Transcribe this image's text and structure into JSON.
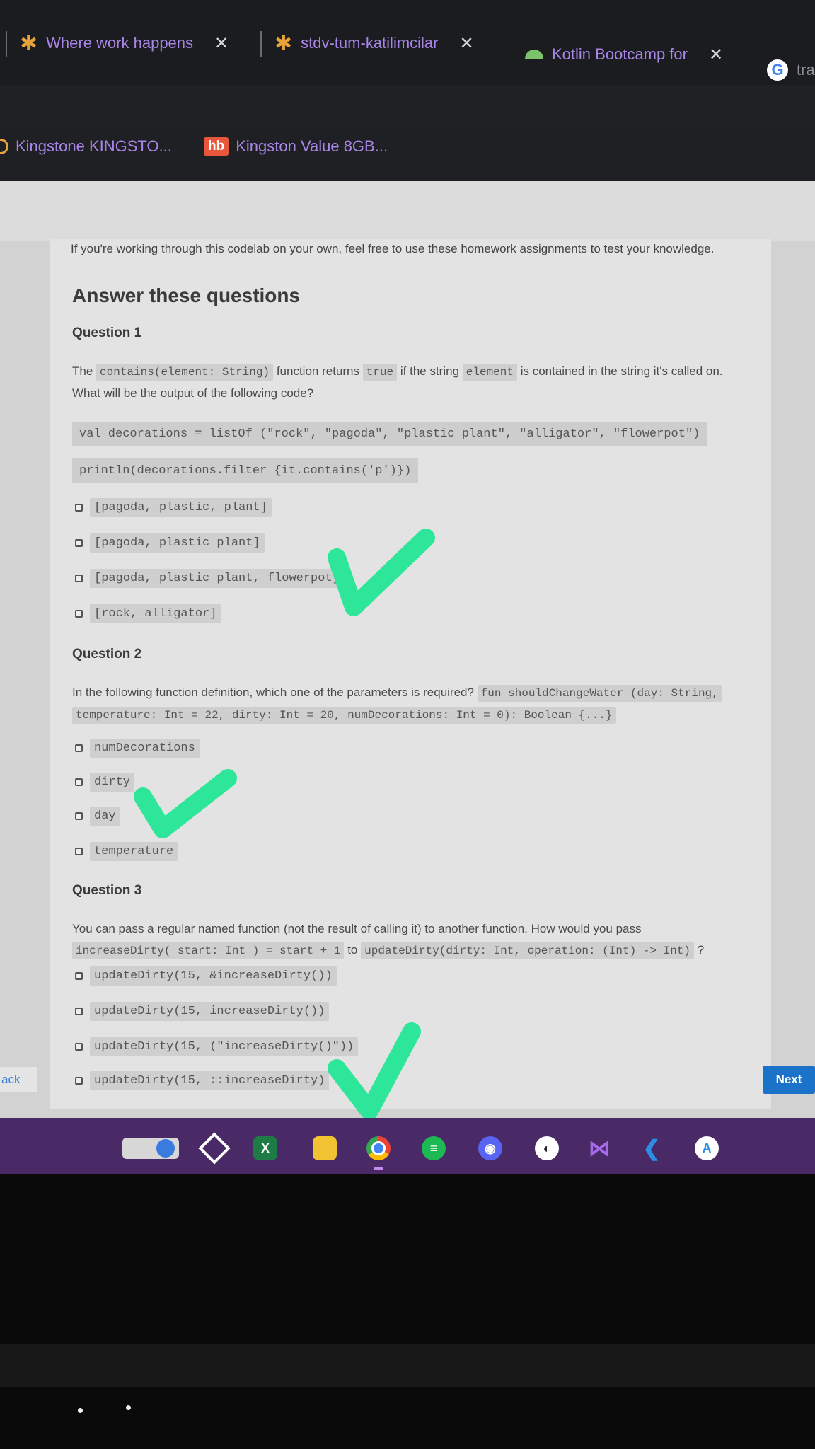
{
  "browser": {
    "tabs": [
      {
        "label": "Where work happens",
        "icon": "slack-icon"
      },
      {
        "label": "stdv-tum-katilimcilar",
        "icon": "slack-icon"
      },
      {
        "label": "Kotlin Bootcamp for",
        "icon": "android-icon"
      },
      {
        "label": "tra",
        "icon": "google-icon"
      }
    ],
    "bookmarks": [
      {
        "label": "Kingstone KINGSTO...",
        "icon": "circle-icon"
      },
      {
        "label": "Kingston Value 8GB...",
        "badge": "hb"
      }
    ]
  },
  "codelab": {
    "intro": "If you're working through this codelab on your own, feel free to use these homework assignments to test your knowledge.",
    "heading": "Answer these questions",
    "q1": {
      "title": "Question 1",
      "text_a": "The",
      "code_a": "contains(element: String)",
      "text_b": "function returns",
      "code_b": "true",
      "text_c": "if the string",
      "code_c": "element",
      "text_d": "is contained in the string it's called on.",
      "text_e": "What will be the output of the following code?",
      "code_line1": "val decorations = listOf (\"rock\", \"pagoda\", \"plastic plant\", \"alligator\", \"flowerpot\")",
      "code_line2": "println(decorations.filter {it.contains('p')})",
      "options": [
        "[pagoda, plastic, plant]",
        "[pagoda, plastic plant]",
        "[pagoda, plastic plant, flowerpot]",
        "[rock, alligator]"
      ]
    },
    "q2": {
      "title": "Question 2",
      "text_a": "In the following function definition, which one of the parameters is required?",
      "code_a": "fun shouldChangeWater (day: String,",
      "code_b": "temperature: Int = 22, dirty: Int = 20, numDecorations: Int = 0): Boolean {...}",
      "options": [
        "numDecorations",
        "dirty",
        "day",
        "temperature"
      ]
    },
    "q3": {
      "title": "Question 3",
      "text_a": "You can pass a regular named function (not the result of calling it) to another function. How would you pass",
      "code_a": "increaseDirty( start: Int ) = start + 1",
      "text_b": "to",
      "code_b": "updateDirty(dirty: Int, operation: (Int) -> Int)",
      "text_c": "?",
      "options": [
        "updateDirty(15, &increaseDirty())",
        "updateDirty(15, increaseDirty())",
        "updateDirty(15, (\"increaseDirty()\"))",
        "updateDirty(15, ::increaseDirty)"
      ]
    },
    "back_label": "ack",
    "next_label": "Next"
  },
  "annotations": {
    "checkmark_color": "#2ee69a"
  },
  "taskbar": {
    "apps": [
      "launchpad-icon",
      "unity-icon",
      "excel-icon",
      "files-icon",
      "chrome-icon",
      "spotify-icon",
      "discord-icon",
      "github-icon",
      "visual-studio-icon",
      "vscode-icon",
      "appstore-icon"
    ],
    "excel_glyph": "X"
  },
  "colors": {
    "link_purple": "#a985e8",
    "next_blue": "#1a73c9",
    "taskbar": "#4a2a66"
  }
}
